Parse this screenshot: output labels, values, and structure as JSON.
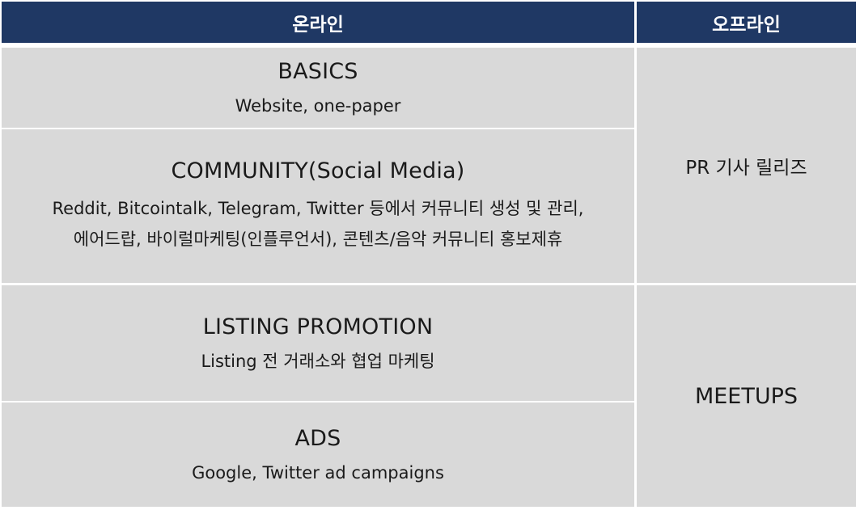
{
  "header": {
    "online": "온라인",
    "offline": "오프라인"
  },
  "online": {
    "basics": {
      "title": "BASICS",
      "desc": "Website, one-paper"
    },
    "community": {
      "title": "COMMUNITY(Social  Media)",
      "desc_line1": "Reddit, Bitcointalk, Telegram, Twitter 등에서 커뮤니티 생성 및 관리,",
      "desc_line2": "에어드랍, 바이럴마케팅(인플루언서), 콘텐츠/음악 커뮤니티 홍보제휴"
    },
    "listing": {
      "title": "LISTING PROMOTION",
      "desc": "Listing 전 거래소와 협업 마케팅"
    },
    "ads": {
      "title": "ADS",
      "desc": "Google, Twitter ad campaigns"
    }
  },
  "offline": {
    "pr": "PR 기사 릴리즈",
    "meetups": "MEETUPS"
  },
  "colors": {
    "header_bg": "#1f3864",
    "cell_bg": "#d9d9d9",
    "divider": "#ffffff"
  }
}
